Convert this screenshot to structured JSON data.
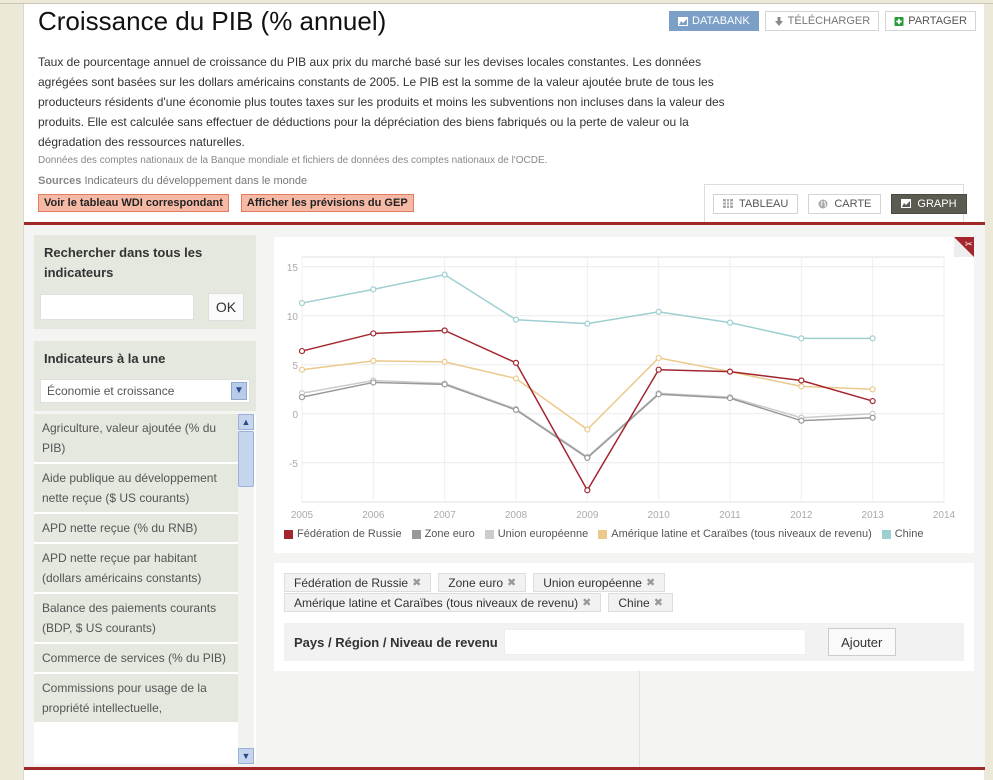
{
  "page": {
    "title": "Croissance du PIB (% annuel)",
    "description": "Taux de pourcentage annuel de croissance du PIB aux prix du marché basé sur les devises locales constantes. Les données agrégées sont basées sur les dollars américains constants de 2005. Le PIB est la somme de la valeur ajoutée brute de tous les producteurs résidents d'une économie plus toutes taxes sur les produits et moins les subventions non incluses dans la valeur des produits. Elle est calculée sans effectuer de déductions pour la dépréciation des biens fabriqués ou la perte de valeur ou la dégradation des ressources naturelles.",
    "note": "Données des comptes nationaux de la Banque mondiale et fichiers de données des comptes nationaux de l'OCDE.",
    "sources_label": "Sources",
    "sources_text": "Indicateurs du développement dans le monde"
  },
  "top_buttons": {
    "databank": "DATABANK",
    "download": "TÉLÉCHARGER",
    "share": "PARTAGER"
  },
  "red_buttons": {
    "wdi": "Voir le tableau WDI correspondant",
    "gep": "Afficher les prévisions du GEP"
  },
  "view_tabs": {
    "table": "TABLEAU",
    "map": "CARTE",
    "graph": "GRAPH",
    "active": "GRAPH"
  },
  "sidebar": {
    "search_title": "Rechercher dans tous les indicateurs",
    "search_value": "",
    "ok_label": "OK",
    "featured_title": "Indicateurs à la une",
    "featured_select": "Économie et croissance",
    "indicators": [
      "Agriculture, valeur ajoutée (% du PIB)",
      "Aide publique au développement nette reçue ($ US courants)",
      "APD nette reçue (% du RNB)",
      "APD nette reçue par habitant (dollars américains constants)",
      "Balance des paiements courants (BDP, $ US courants)",
      "Commerce de services (% du PIB)",
      "Commissions pour usage de la propriété intellectuelle,"
    ]
  },
  "selection": {
    "tags": [
      "Fédération de Russie",
      "Zone euro",
      "Union européenne",
      "Amérique latine et Caraïbes (tous niveaux de revenu)",
      "Chine"
    ],
    "add_label": "Pays / Région / Niveau de revenu",
    "add_input_value": "",
    "add_button": "Ajouter"
  },
  "chart_data": {
    "type": "line",
    "title": "Croissance du PIB (% annuel)",
    "xlabel": "",
    "ylabel": "",
    "x": [
      2005,
      2006,
      2007,
      2008,
      2009,
      2010,
      2011,
      2012,
      2013
    ],
    "x_ticks": [
      "2005",
      "2006",
      "2007",
      "2008",
      "2009",
      "2010",
      "2011",
      "2012",
      "2013",
      "2014"
    ],
    "y_ticks": [
      "15",
      "10",
      "5",
      "0",
      "-5"
    ],
    "xlim": [
      2005,
      2014
    ],
    "ylim": [
      -9,
      16
    ],
    "grid": true,
    "legend_position": "bottom",
    "series": [
      {
        "name": "Fédération de Russie",
        "color": "#a3262e",
        "values": [
          6.4,
          8.2,
          8.5,
          5.2,
          -7.8,
          4.5,
          4.3,
          3.4,
          1.3
        ]
      },
      {
        "name": "Zone euro",
        "color": "#999999",
        "values": [
          1.7,
          3.2,
          3.0,
          0.4,
          -4.5,
          2.0,
          1.6,
          -0.7,
          -0.4
        ]
      },
      {
        "name": "Union européenne",
        "color": "#cccccc",
        "values": [
          2.1,
          3.4,
          3.1,
          0.5,
          -4.4,
          2.1,
          1.7,
          -0.4,
          0.0
        ]
      },
      {
        "name": "Amérique latine et Caraïbes (tous niveaux de revenu)",
        "color": "#ebc98a",
        "values": [
          4.5,
          5.4,
          5.3,
          3.6,
          -1.6,
          5.7,
          4.3,
          2.8,
          2.5
        ]
      },
      {
        "name": "Chine",
        "color": "#9ecfd0",
        "values": [
          11.3,
          12.7,
          14.2,
          9.6,
          9.2,
          10.4,
          9.3,
          7.7,
          7.7
        ]
      }
    ]
  }
}
